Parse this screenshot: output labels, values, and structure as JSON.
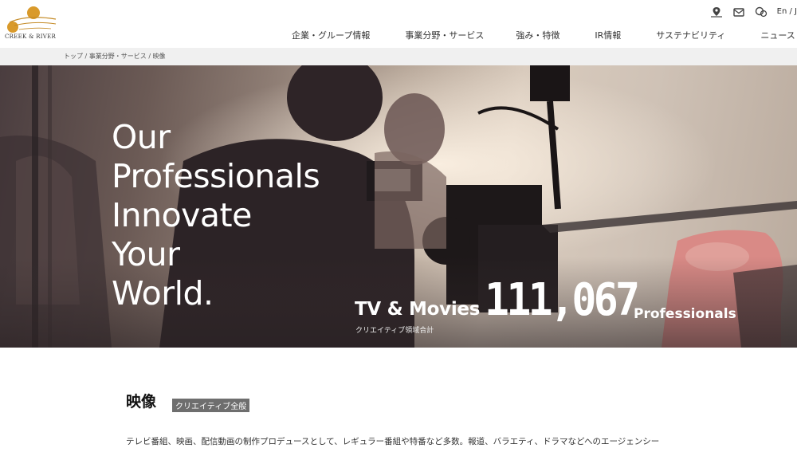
{
  "header": {
    "logo_text": "CREEK & RIVER",
    "util": {
      "map_icon": "map-pin-icon",
      "mail_icon": "mail-icon",
      "chat_icon": "chat-icon",
      "lang_label": "En / J"
    },
    "nav": [
      {
        "label": "企業・グループ情報"
      },
      {
        "label": "事業分野・サービス"
      },
      {
        "label": "強み・特徴"
      },
      {
        "label": "IR情報"
      },
      {
        "label": "サステナビリティ"
      },
      {
        "label": "ニュースリリース"
      }
    ]
  },
  "breadcrumb": "トップ / 事業分野・サービス / 映像",
  "hero": {
    "title_lines": [
      "Our",
      "Professionals",
      "Innovate",
      "Your",
      "World."
    ],
    "category": "TV & Movies",
    "sub_label": "クリエイティブ領域合計",
    "count": "111,067",
    "unit": "Professionals"
  },
  "section": {
    "title": "映像",
    "badge": "クリエイティブ全般",
    "body": "テレビ番組、映画、配信動画の制作プロデュースとして、レギュラー番組や特番など多数。報道、バラエティ、ドラマなどへのエージェンシー"
  },
  "colors": {
    "logo_gold": "#d99a2b",
    "badge_bg": "#6e6e6e",
    "breadcrumb_bg": "#f0f0f0"
  }
}
